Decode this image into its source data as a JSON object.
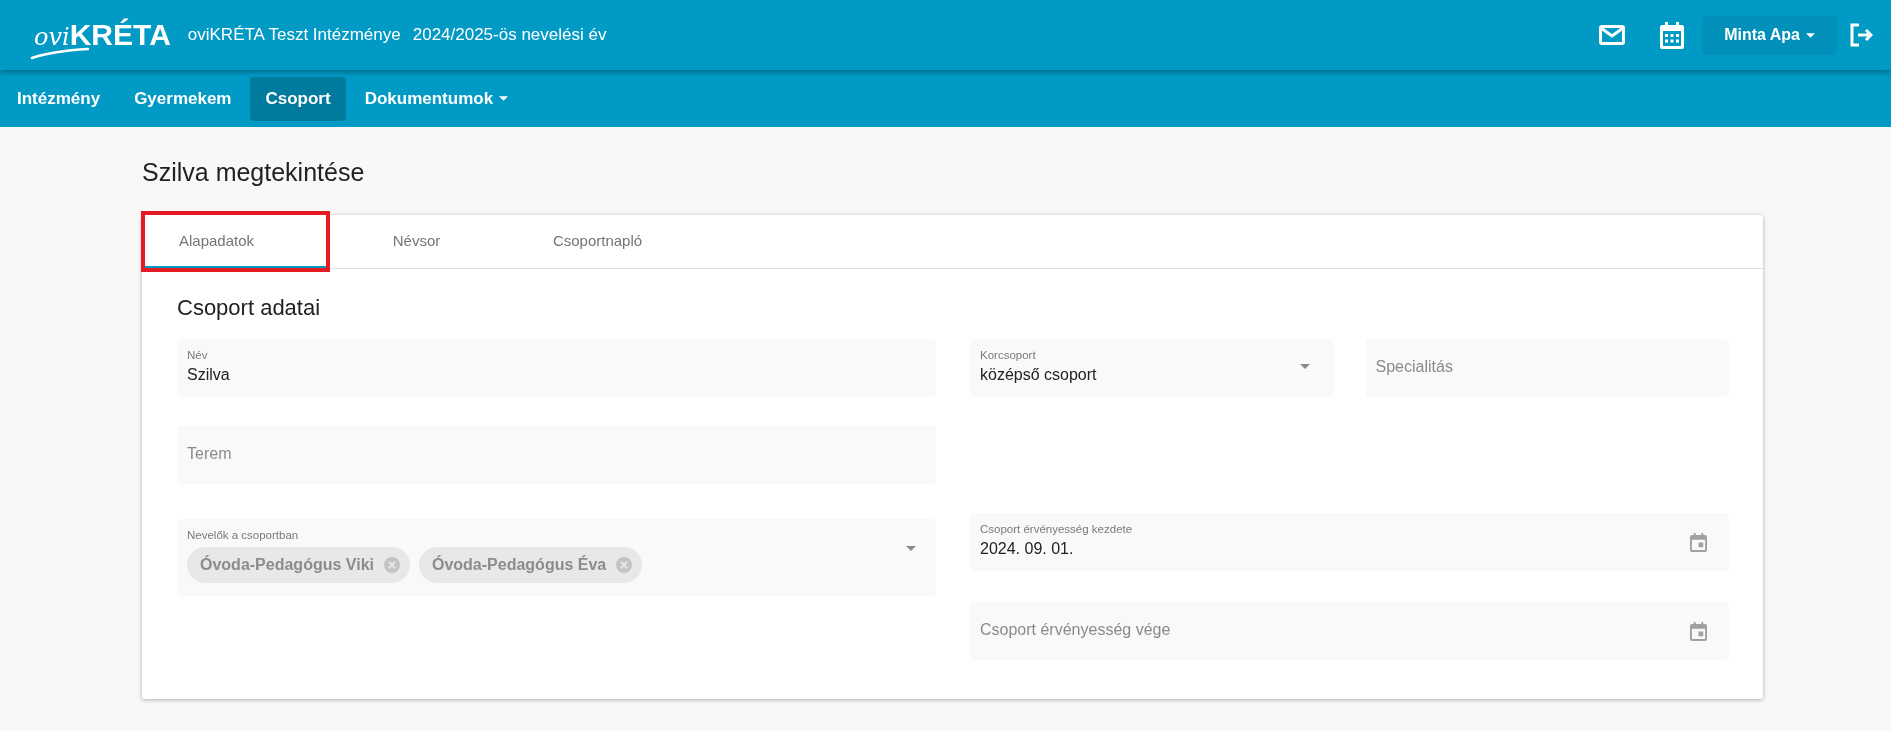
{
  "header": {
    "logo": {
      "script": "ovi",
      "wordmark": "KRÉTA"
    },
    "institution": "oviKRÉTA Teszt Intézménye",
    "school_year": "2024/2025-ös nevelési év",
    "user": "Minta Apa"
  },
  "nav": [
    {
      "label": "Intézmény",
      "selected": false,
      "dropdown": false
    },
    {
      "label": "Gyermekem",
      "selected": false,
      "dropdown": false
    },
    {
      "label": "Csoport",
      "selected": true,
      "dropdown": false
    },
    {
      "label": "Dokumentumok",
      "selected": false,
      "dropdown": true
    }
  ],
  "page_title": "Szilva megtekintése",
  "tabs": [
    {
      "label": "Alapadatok",
      "selected": true,
      "highlighted": true
    },
    {
      "label": "Névsor",
      "selected": false,
      "highlighted": false
    },
    {
      "label": "Csoportnapló",
      "selected": false,
      "highlighted": false
    }
  ],
  "section_title": "Csoport adatai",
  "left_column": [
    {
      "kind": "text",
      "label": "Név",
      "value": "Szilva"
    },
    {
      "kind": "text",
      "placeholder": "Terem"
    },
    {
      "kind": "chips",
      "label": "Nevelők a csoportban",
      "chips": [
        "Óvoda-Pedagógus Viki",
        "Óvoda-Pedagógus Éva"
      ]
    }
  ],
  "right_column": [
    {
      "kind": "pair",
      "fields": [
        {
          "kind": "select",
          "label": "Korcsoport",
          "value": "középső csoport"
        },
        {
          "kind": "text",
          "placeholder": "Specialitás"
        }
      ]
    },
    {
      "kind": "date",
      "label": "Csoport érvényesség kezdete",
      "value": "2024. 09. 01."
    },
    {
      "kind": "date",
      "placeholder": "Csoport érvényesség vége"
    }
  ]
}
